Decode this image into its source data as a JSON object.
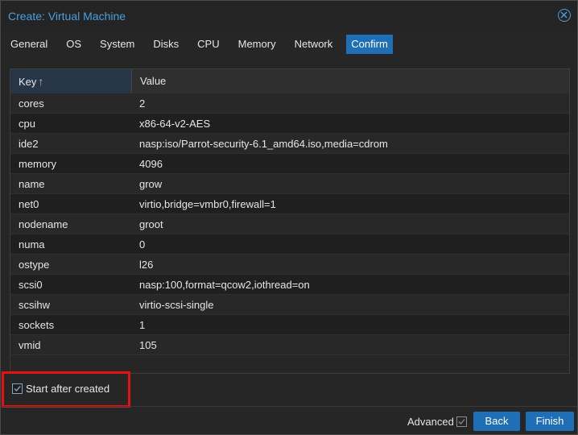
{
  "window": {
    "title": "Create: Virtual Machine"
  },
  "tabs": [
    {
      "label": "General"
    },
    {
      "label": "OS"
    },
    {
      "label": "System"
    },
    {
      "label": "Disks"
    },
    {
      "label": "CPU"
    },
    {
      "label": "Memory"
    },
    {
      "label": "Network"
    },
    {
      "label": "Confirm",
      "active": true
    }
  ],
  "grid": {
    "headers": {
      "key": "Key",
      "value": "Value"
    },
    "sort": "ascending",
    "rows": [
      {
        "key": "cores",
        "value": "2"
      },
      {
        "key": "cpu",
        "value": "x86-64-v2-AES"
      },
      {
        "key": "ide2",
        "value": "nasp:iso/Parrot-security-6.1_amd64.iso,media=cdrom"
      },
      {
        "key": "memory",
        "value": "4096"
      },
      {
        "key": "name",
        "value": "grow"
      },
      {
        "key": "net0",
        "value": "virtio,bridge=vmbr0,firewall=1"
      },
      {
        "key": "nodename",
        "value": "groot"
      },
      {
        "key": "numa",
        "value": "0"
      },
      {
        "key": "ostype",
        "value": "l26"
      },
      {
        "key": "scsi0",
        "value": "nasp:100,format=qcow2,iothread=on"
      },
      {
        "key": "scsihw",
        "value": "virtio-scsi-single"
      },
      {
        "key": "sockets",
        "value": "1"
      },
      {
        "key": "vmid",
        "value": "105"
      }
    ]
  },
  "start_after_created": {
    "label": "Start after created",
    "checked": true
  },
  "footer": {
    "advanced_label": "Advanced",
    "advanced_checked": true,
    "back_label": "Back",
    "finish_label": "Finish"
  },
  "colors": {
    "accent": "#1e6fb5",
    "title": "#4a9fe0",
    "highlight": "#e31313"
  }
}
